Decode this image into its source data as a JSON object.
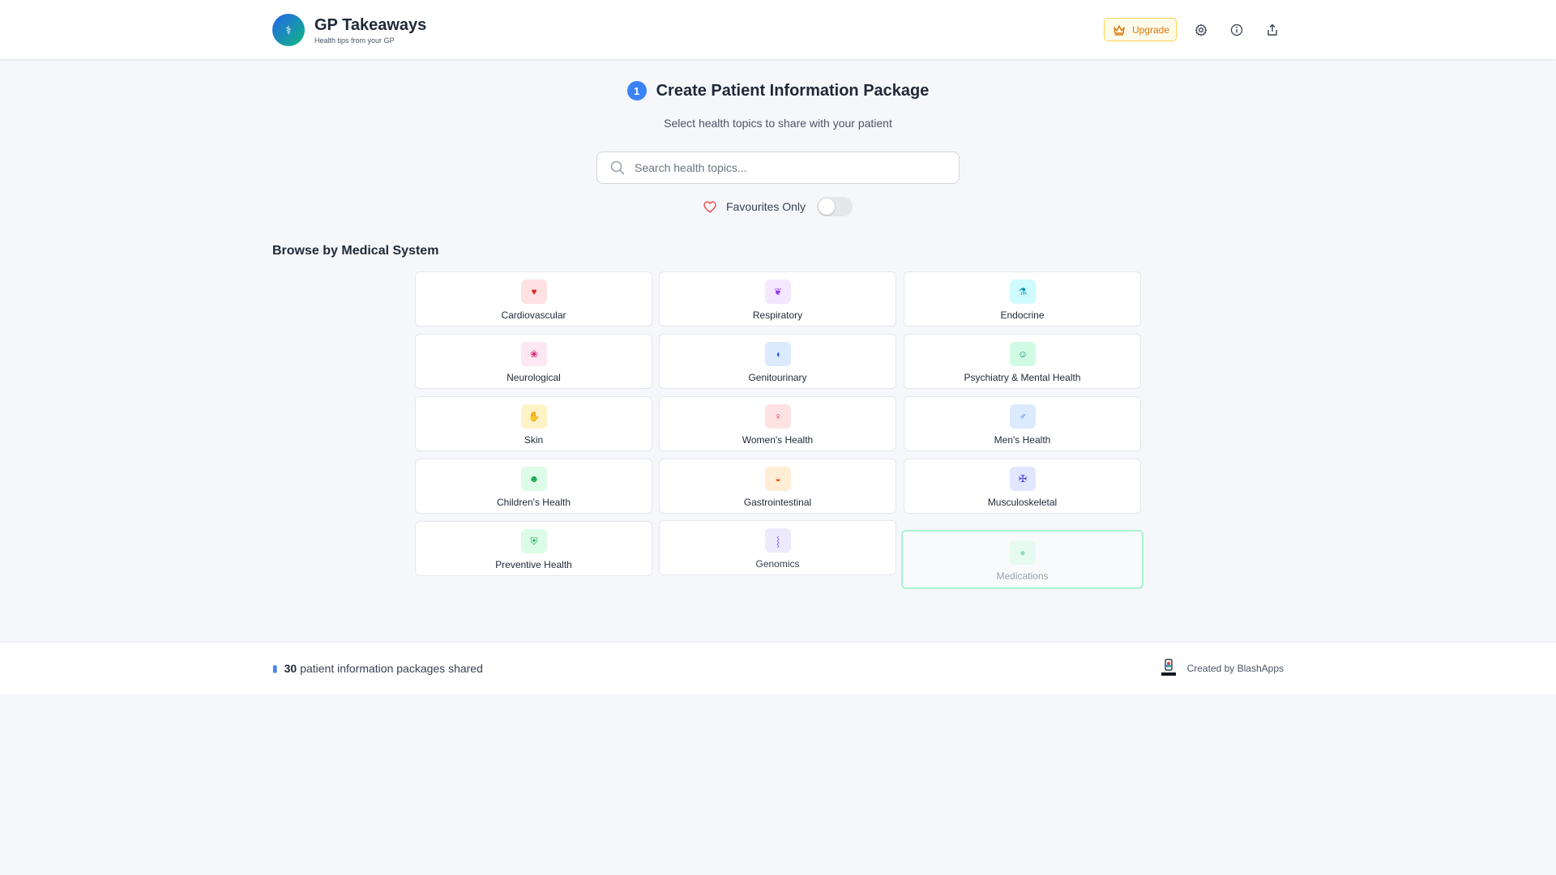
{
  "header": {
    "app_title": "GP Takeaways",
    "app_subtitle": "Health tips from your GP",
    "upgrade_label": "Upgrade",
    "logo_icon": "stethoscope-icon"
  },
  "step": {
    "number": "1",
    "title": "Create Patient Information Package",
    "subtitle": "Select health topics to share with your patient"
  },
  "search": {
    "placeholder": "Search health topics...",
    "value": ""
  },
  "favourites": {
    "label": "Favourites Only",
    "enabled": false
  },
  "section_title": "Browse by Medical System",
  "systems": [
    {
      "label": "Cardiovascular",
      "icon": "heart-icon",
      "bg": "#fee2e2",
      "fg": "#dc2626"
    },
    {
      "label": "Respiratory",
      "icon": "lungs-icon",
      "bg": "#f3e8ff",
      "fg": "#9333ea"
    },
    {
      "label": "Endocrine",
      "icon": "flask-icon",
      "bg": "#cffafe",
      "fg": "#0891b2"
    },
    {
      "label": "Neurological",
      "icon": "brain-icon",
      "bg": "#fce7f3",
      "fg": "#db2777"
    },
    {
      "label": "Genitourinary",
      "icon": "kidney-icon",
      "bg": "#dbeafe",
      "fg": "#2563eb"
    },
    {
      "label": "Psychiatry & Mental Health",
      "icon": "mind-icon",
      "bg": "#d1fae5",
      "fg": "#059669"
    },
    {
      "label": "Skin",
      "icon": "hand-icon",
      "bg": "#fef3c7",
      "fg": "#d97706"
    },
    {
      "label": "Women's Health",
      "icon": "female-icon",
      "bg": "#fee2e2",
      "fg": "#e11d48"
    },
    {
      "label": "Men's Health",
      "icon": "male-icon",
      "bg": "#dbeafe",
      "fg": "#2563eb"
    },
    {
      "label": "Children's Health",
      "icon": "child-icon",
      "bg": "#dcfce7",
      "fg": "#16a34a"
    },
    {
      "label": "Gastrointestinal",
      "icon": "stomach-icon",
      "bg": "#ffedd5",
      "fg": "#ea580c"
    },
    {
      "label": "Musculoskeletal",
      "icon": "bone-icon",
      "bg": "#e0e7ff",
      "fg": "#4f46e5"
    },
    {
      "label": "Preventive Health",
      "icon": "shield-icon",
      "bg": "#dcfce7",
      "fg": "#16a34a"
    },
    {
      "label": "Genomics",
      "icon": "dna-icon",
      "bg": "#ede9fe",
      "fg": "#7c3aed"
    },
    {
      "label": "Medications",
      "icon": "pill-icon",
      "bg": "#d1fae5",
      "fg": "#10b981"
    }
  ],
  "footer": {
    "count": "30",
    "count_text": "patient information packages shared",
    "credit": "Created by BlashApps"
  }
}
